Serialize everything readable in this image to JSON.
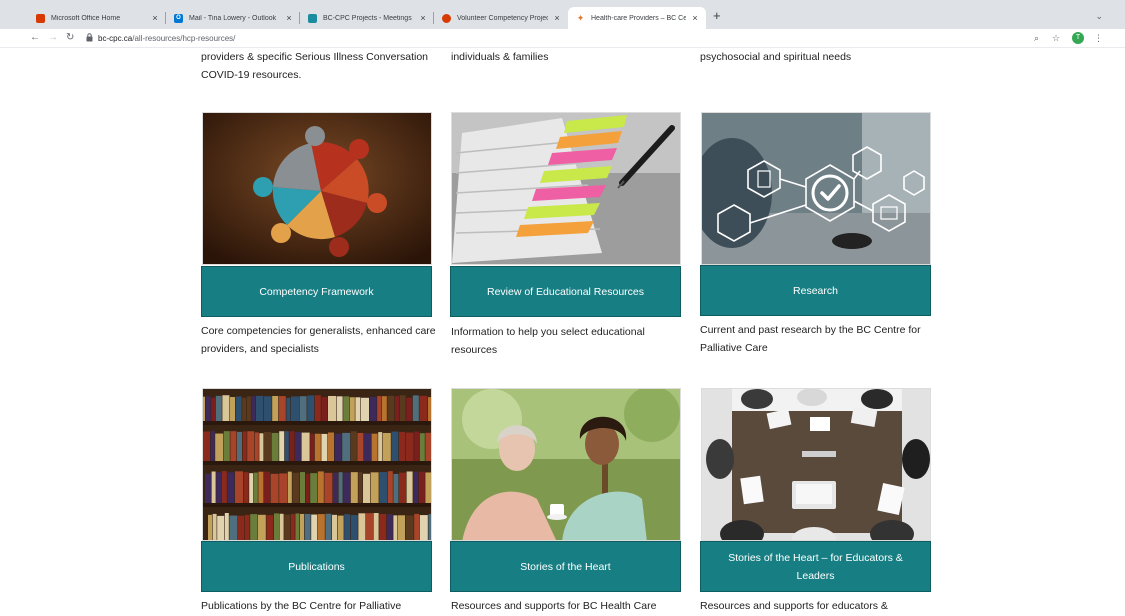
{
  "browser": {
    "tabs": [
      {
        "title": "Microsoft Office Home",
        "icon": "office-icon",
        "color": "#d83b01",
        "active": false
      },
      {
        "title": "Mail - Tina Lowery - Outlook",
        "icon": "outlook-icon",
        "color": "#0078d4",
        "active": false
      },
      {
        "title": "BC-CPC Projects - Meetings -",
        "icon": "teams-icon",
        "color": "#1a8e9e",
        "active": false
      },
      {
        "title": "Volunteer Competency Project",
        "icon": "office-icon",
        "color": "#d83b01",
        "active": false
      },
      {
        "title": "Health-care Providers – BC Ce",
        "icon": "bccpc-icon",
        "color": "#e07a2f",
        "active": true
      }
    ],
    "address": {
      "host": "bc-cpc.ca",
      "path": "/all-resources/hcp-resources/"
    },
    "profile_initial": "T"
  },
  "page": {
    "top_descriptions": [
      "providers & specific Serious Illness Conversation COVID-19 resources.",
      "individuals & families",
      "psychosocial and spiritual needs"
    ],
    "cards": [
      {
        "label": "Competency Framework",
        "description": "Core competencies for generalists, enhanced care providers, and specialists",
        "image": "puzzle-image"
      },
      {
        "label": "Review of Educational Resources",
        "description": "Information to help you select educational resources",
        "image": "sticky-notes-image"
      },
      {
        "label": "Research",
        "description": "Current and past research by the BC Centre for Palliative Care",
        "image": "research-icons-image"
      },
      {
        "label": "Publications",
        "description": "Publications by the BC Centre for Palliative",
        "image": "bookshelf-image"
      },
      {
        "label": "Stories of the Heart",
        "description": "Resources and supports for BC Health Care",
        "image": "caregiver-image"
      },
      {
        "label": "Stories of the Heart – for Educators & Leaders",
        "description": "Resources and supports for educators &",
        "image": "meeting-table-image"
      }
    ],
    "colors": {
      "button": "#177f83",
      "text": "#1f1f1f"
    }
  }
}
